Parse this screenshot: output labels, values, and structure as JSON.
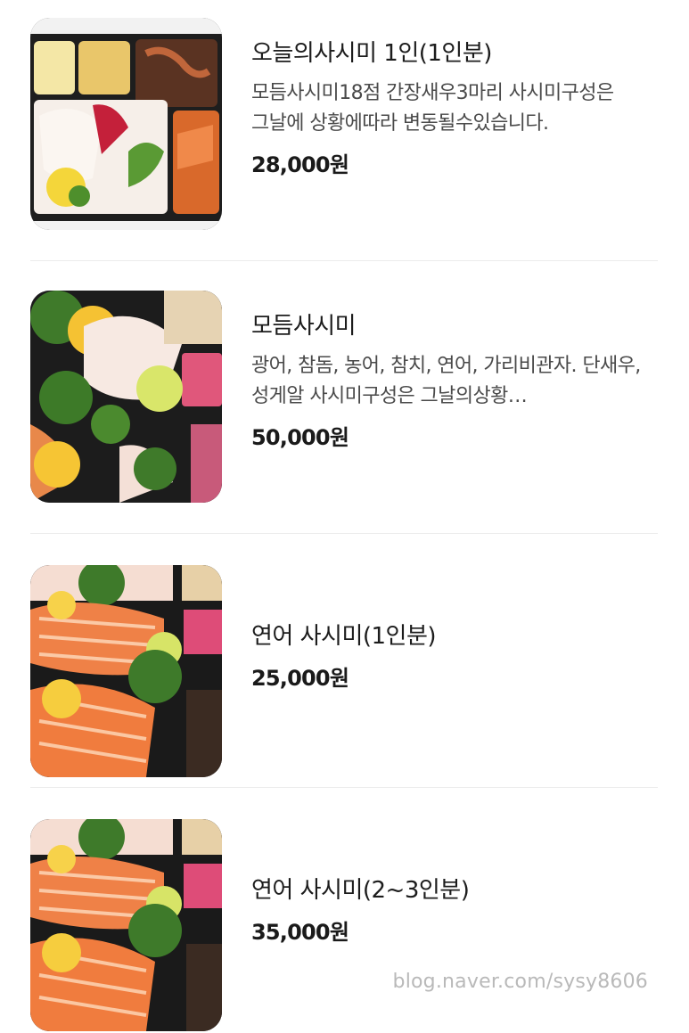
{
  "menu": {
    "items": [
      {
        "name": "오늘의사시미 1인(1인분)",
        "description": "모듬사시미18점 간장새우3마리 사시미구성은 그날에 상황에따라 변동될수있습니다.",
        "price": "28,000원",
        "image_icon": "sashimi-platter-photo"
      },
      {
        "name": "모듬사시미",
        "description": "광어, 참돔, 농어, 참치, 연어, 가리비관자. 단새우, 성게알 사시미구성은 그날의상황…",
        "price": "50,000원",
        "image_icon": "assorted-sashimi-photo"
      },
      {
        "name": "연어 사시미(1인분)",
        "price": "25,000원",
        "image_icon": "salmon-sashimi-photo"
      },
      {
        "name": "연어 사시미(2~3인분)",
        "price": "35,000원",
        "image_icon": "salmon-sashimi-photo"
      }
    ]
  },
  "watermark": "blog.naver.com/sysy8606"
}
